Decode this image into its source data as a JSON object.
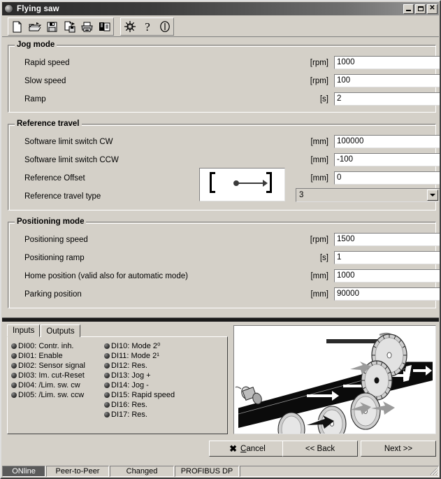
{
  "window": {
    "title": "Flying saw",
    "icon": "app-icon",
    "minimize": "–",
    "maximize": "□",
    "close": "✕"
  },
  "toolbar": {
    "buttons": [
      {
        "name": "new-file-icon",
        "tooltip": "New"
      },
      {
        "name": "open-folder-icon",
        "tooltip": "Open"
      },
      {
        "name": "save-floppy-icon",
        "tooltip": "Save"
      },
      {
        "name": "save-as-icon",
        "tooltip": "Save as"
      },
      {
        "name": "print-icon",
        "tooltip": "Print"
      },
      {
        "name": "print-preview-icon",
        "tooltip": "Print preview"
      }
    ],
    "buttons2": [
      {
        "name": "settings-tool-icon",
        "tooltip": "Settings"
      },
      {
        "name": "help-question-icon",
        "tooltip": "Help"
      },
      {
        "name": "info-circle-icon",
        "tooltip": "Info"
      }
    ]
  },
  "groups": {
    "jog": {
      "title": "Jog mode",
      "rows": [
        {
          "label": "Rapid speed",
          "unit": "[rpm]",
          "value": "1000"
        },
        {
          "label": "Slow speed",
          "unit": "[rpm]",
          "value": "100"
        },
        {
          "label": "Ramp",
          "unit": "[s]",
          "value": "2"
        }
      ]
    },
    "reference": {
      "title": "Reference travel",
      "rows": [
        {
          "label": "Software limit switch CW",
          "unit": "[mm]",
          "value": "100000"
        },
        {
          "label": "Software limit switch CCW",
          "unit": "[mm]",
          "value": "-100"
        },
        {
          "label": "Reference Offset",
          "unit": "[mm]",
          "value": "0"
        }
      ],
      "type_label": "Reference travel type",
      "type_value": "3",
      "picture": "reference-travel-type-diagram"
    },
    "positioning": {
      "title": "Positioning mode",
      "rows": [
        {
          "label": "Positioning speed",
          "unit": "[rpm]",
          "value": "1500"
        },
        {
          "label": "Positioning ramp",
          "unit": "[s]",
          "value": "1"
        },
        {
          "label": "Home position (valid also for automatic mode)",
          "unit": "[mm]",
          "value": "1000"
        },
        {
          "label": "Parking position",
          "unit": "[mm]",
          "value": "90000"
        }
      ]
    }
  },
  "io": {
    "tabs": [
      {
        "label": "Inputs",
        "active": true
      },
      {
        "label": "Outputs",
        "active": false
      }
    ],
    "column1": [
      "DI00: Contr. inh.",
      "DI01: Enable",
      "DI02: Sensor signal",
      "DI03: Im. cut-Reset",
      "DI04: /Lim. sw. cw",
      "DI05: /Lim. sw. ccw"
    ],
    "column2": [
      "DI10: Mode 2⁰",
      "DI11: Mode 2¹",
      "DI12: Res.",
      "DI13: Jog +",
      "DI14: Jog -",
      "DI15: Rapid speed",
      "DI16: Res.",
      "DI17: Res."
    ]
  },
  "picture": {
    "name": "flying-saw-illustration"
  },
  "footer": {
    "cancel": "Cancel",
    "cancel_accel": "C",
    "back": "<< Back",
    "next": "Next >>"
  },
  "statusbar": {
    "connection": "ONline",
    "mode": "Peer-to-Peer",
    "state": "Changed",
    "fieldbus": "PROFIBUS DP",
    "extra": ""
  },
  "colors": {
    "face": "#d4d0c8",
    "titlebar_dark": "#2b2b2b",
    "field_bg": "#ffffff",
    "status_online_bg": "#5a5a5a"
  }
}
